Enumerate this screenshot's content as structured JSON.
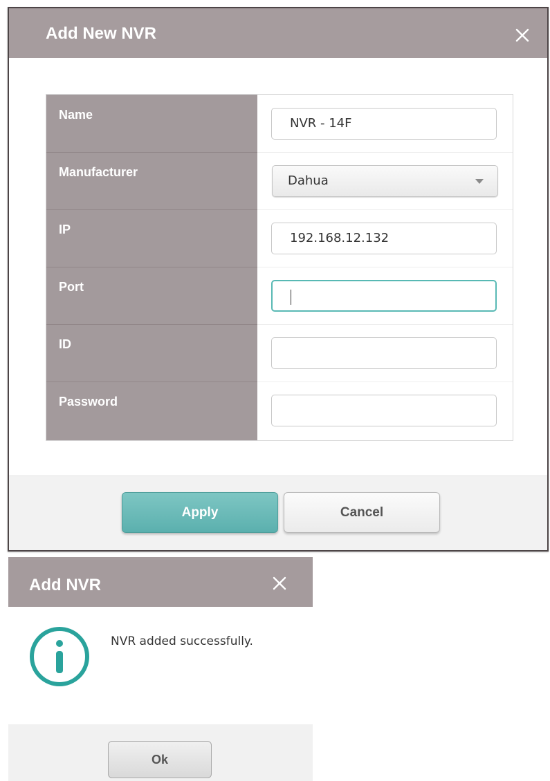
{
  "add_new_nvr_dialog": {
    "title": "Add New NVR",
    "fields": [
      {
        "label": "Name",
        "value": "NVR - 14F",
        "type": "text"
      },
      {
        "label": "Manufacturer",
        "value": "Dahua",
        "type": "select"
      },
      {
        "label": "IP",
        "value": "192.168.12.132",
        "type": "text"
      },
      {
        "label": "Port",
        "value": "",
        "type": "text",
        "focused": true
      },
      {
        "label": "ID",
        "value": "",
        "type": "text"
      },
      {
        "label": "Password",
        "value": "",
        "type": "password"
      }
    ],
    "apply_label": "Apply",
    "cancel_label": "Cancel"
  },
  "add_nvr_dialog": {
    "title": "Add NVR",
    "message": "NVR added successfully.",
    "ok_label": "Ok"
  },
  "colors": {
    "header_bg": "#a69c9e",
    "label_col_bg": "#a39a9c",
    "accent_teal": "#5bb0ae",
    "info_icon": "#2aa39c"
  },
  "icons": {
    "close": "close-icon",
    "dropdown": "chevron-down-icon",
    "info": "info-icon"
  }
}
